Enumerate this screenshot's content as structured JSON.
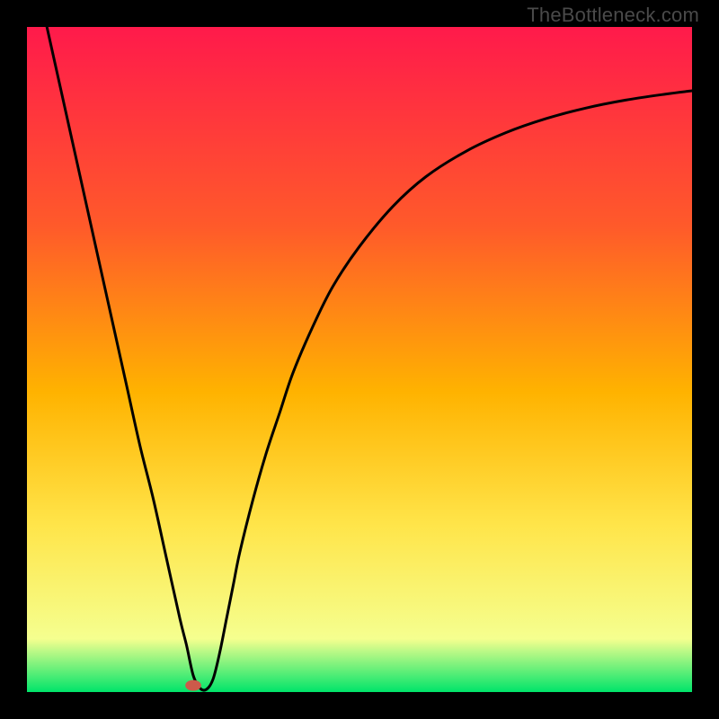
{
  "watermark": "TheBottleneck.com",
  "chart_data": {
    "type": "line",
    "title": "",
    "xlabel": "",
    "ylabel": "",
    "xlim": [
      0,
      100
    ],
    "ylim": [
      0,
      100
    ],
    "legend": false,
    "background_gradient": {
      "top": "#ff1a4b",
      "mid1": "#ff5a2a",
      "mid2": "#ffb300",
      "mid3": "#ffe54a",
      "mid4": "#f5ff8f",
      "bottom": "#00e46a"
    },
    "marker": {
      "x": 25,
      "y": 1,
      "color": "#cc5a4a",
      "size": 4
    },
    "series": [
      {
        "name": "curve",
        "color": "#000000",
        "x": [
          3,
          5,
          7,
          9,
          11,
          13,
          15,
          17,
          19,
          21,
          23,
          24,
          25,
          26,
          27,
          28,
          29,
          30,
          31,
          32,
          34,
          36,
          38,
          40,
          43,
          46,
          50,
          55,
          60,
          66,
          72,
          78,
          84,
          90,
          96,
          100
        ],
        "y": [
          100,
          91,
          82,
          73,
          64,
          55,
          46,
          37,
          29,
          20,
          11,
          7,
          2.5,
          0.6,
          0.4,
          2,
          6,
          11,
          16,
          21,
          29,
          36,
          42,
          48,
          55,
          61,
          67,
          73,
          77.5,
          81.3,
          84.1,
          86.2,
          87.8,
          89,
          89.9,
          90.4
        ]
      }
    ]
  }
}
